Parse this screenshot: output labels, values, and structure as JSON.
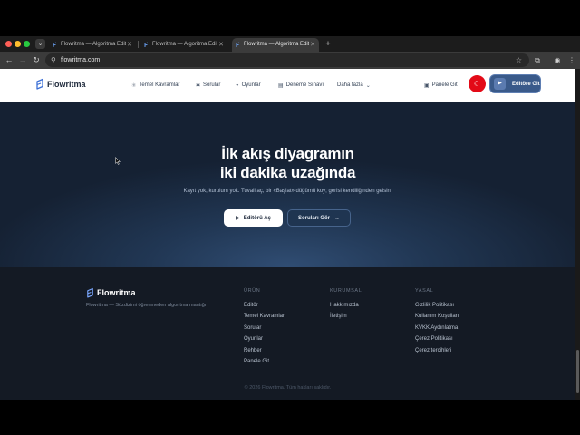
{
  "browser": {
    "tabs": [
      {
        "title": "Flowritma — Algoritma Editörü",
        "active": false
      },
      {
        "title": "Flowritma — Algoritma Editörü",
        "active": false
      },
      {
        "title": "Flowritma — Algoritma Editörü",
        "active": true
      }
    ],
    "url": "flowritma.com"
  },
  "header": {
    "logo": "Flowritma",
    "nav": [
      {
        "label": "Temel Kavramlar",
        "icon": "atom-icon"
      },
      {
        "label": "Sorular",
        "icon": "puzzle-icon"
      },
      {
        "label": "Oyunlar",
        "icon": "gamepad-icon"
      },
      {
        "label": "Deneme Sınavı",
        "icon": "clipboard-icon"
      },
      {
        "label": "Daha fazla",
        "icon": "chevron-down-icon"
      }
    ],
    "panel_link": "Panele Git",
    "language_flag": "tr-flag-icon",
    "editor_button": "Editöre Git"
  },
  "hero": {
    "title_line1": "İlk akış diyagramın",
    "title_line2": "iki dakika uzağında",
    "subtitle": "Kayıt yok, kurulum yok. Tuvali aç, bir «Başlat» düğümü koy; gerisi kendiliğinden gelsin.",
    "primary_button": "Editörü Aç",
    "secondary_button": "Soruları Gör"
  },
  "footer": {
    "logo": "Flowritma",
    "tagline": "Flowritma — Sözdizimi öğrenmeden algoritma mantığı",
    "columns": [
      {
        "heading": "ÜRÜN",
        "links": [
          "Editör",
          "Temel Kavramlar",
          "Sorular",
          "Oyunlar",
          "Rehber",
          "Panele Git"
        ]
      },
      {
        "heading": "KURUMSAL",
        "links": [
          "Hakkımızda",
          "İletişim"
        ]
      },
      {
        "heading": "YASAL",
        "links": [
          "Gizlilik Politikası",
          "Kullanım Koşulları",
          "KVKK Aydınlatma",
          "Çerez Politikası",
          "Çerez tercihleri"
        ]
      }
    ],
    "copyright": "© 2026 Flowritma. Tüm hakları saklıdır."
  },
  "colors": {
    "hero_bg": "#213754",
    "footer_bg": "#141a24",
    "accent": "#3a5a8a",
    "flag_red": "#e30a17"
  }
}
